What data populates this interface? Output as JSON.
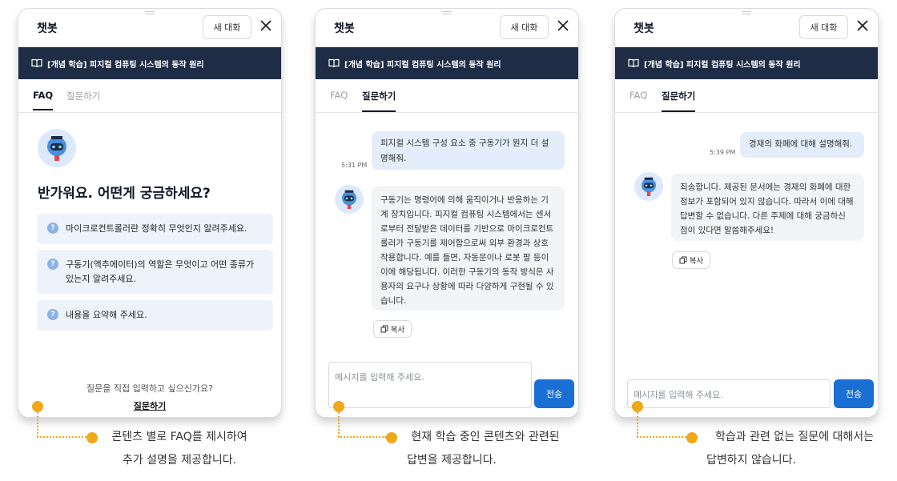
{
  "common": {
    "title": "챗봇",
    "new_chat": "새 대화",
    "banner": "[개념 학습] 피지컬 컴퓨팅 시스템의 동작 원리",
    "tab_faq": "FAQ",
    "tab_ask": "질문하기",
    "copy": "복사",
    "placeholder": "메시지를 입력해 주세요.",
    "send": "전송"
  },
  "panel1": {
    "greeting": "반가워요. 어떤게 궁금하세요?",
    "faqs": [
      "마이크로컨트롤러란 정확히 무엇인지 알려주세요.",
      "구동기(액추에이터)의 역할은 무엇이고 어떤 종류가 있는지 알려주세요.",
      "내용을 요약해 주세요."
    ],
    "prompt": "질문을 직접 입력하고 싶으신가요?",
    "prompt_link": "질문하기"
  },
  "panel2": {
    "user_message": "피지컬 시스템 구성 요소 중 구동기가 뭔지 더 설명해줘.",
    "time": "5:31 PM",
    "bot_message": "구동기는 명령어에 의해 움직이거나 반응하는 기계 장치입니다. 피지컬 컴퓨팅 시스템에서는 센서로부터 전달받은 데이터를 기반으로 마이크로컨트롤러가 구동기를 제어함으로써 외부 환경과 상호작용합니다. 예를 들면, 자동문이나 로봇 팔 등이 이에 해당됩니다. 이러한 구동기의 동작 방식은 사용자의 요구나 상황에 따라 다양하게 구현될 수 있습니다."
  },
  "panel3": {
    "user_message": "경재의 화폐에 대해 설명해줘.",
    "time": "5:39 PM",
    "bot_message": "죄송합니다. 제공된 문서에는 경재의 화폐에 대한 정보가 포함되어 있지 않습니다. 따라서 이에 대해 답변할 수 없습니다. 다른 주제에 대해 궁금하신 점이 있다면 말씀해주세요!"
  },
  "captions": {
    "c1_line1": "콘텐츠 별로 FAQ를 제시하여",
    "c1_line2": "추가 설명을 제공합니다.",
    "c2_line1": "현재 학습 중인 콘텐츠와 관련된",
    "c2_line2": "답변을 제공합니다.",
    "c3_line1": "학습과 관련 없는 질문에 대해서는",
    "c3_line2": "답변하지 않습니다."
  },
  "colors": {
    "banner": "#1e2c45",
    "accent": "#1a6fd4",
    "callout": "#f0a818",
    "user_bubble": "#e3edfb"
  },
  "icons": [
    "book-icon",
    "close-icon",
    "question-icon",
    "copy-icon",
    "robot-avatar-icon"
  ]
}
